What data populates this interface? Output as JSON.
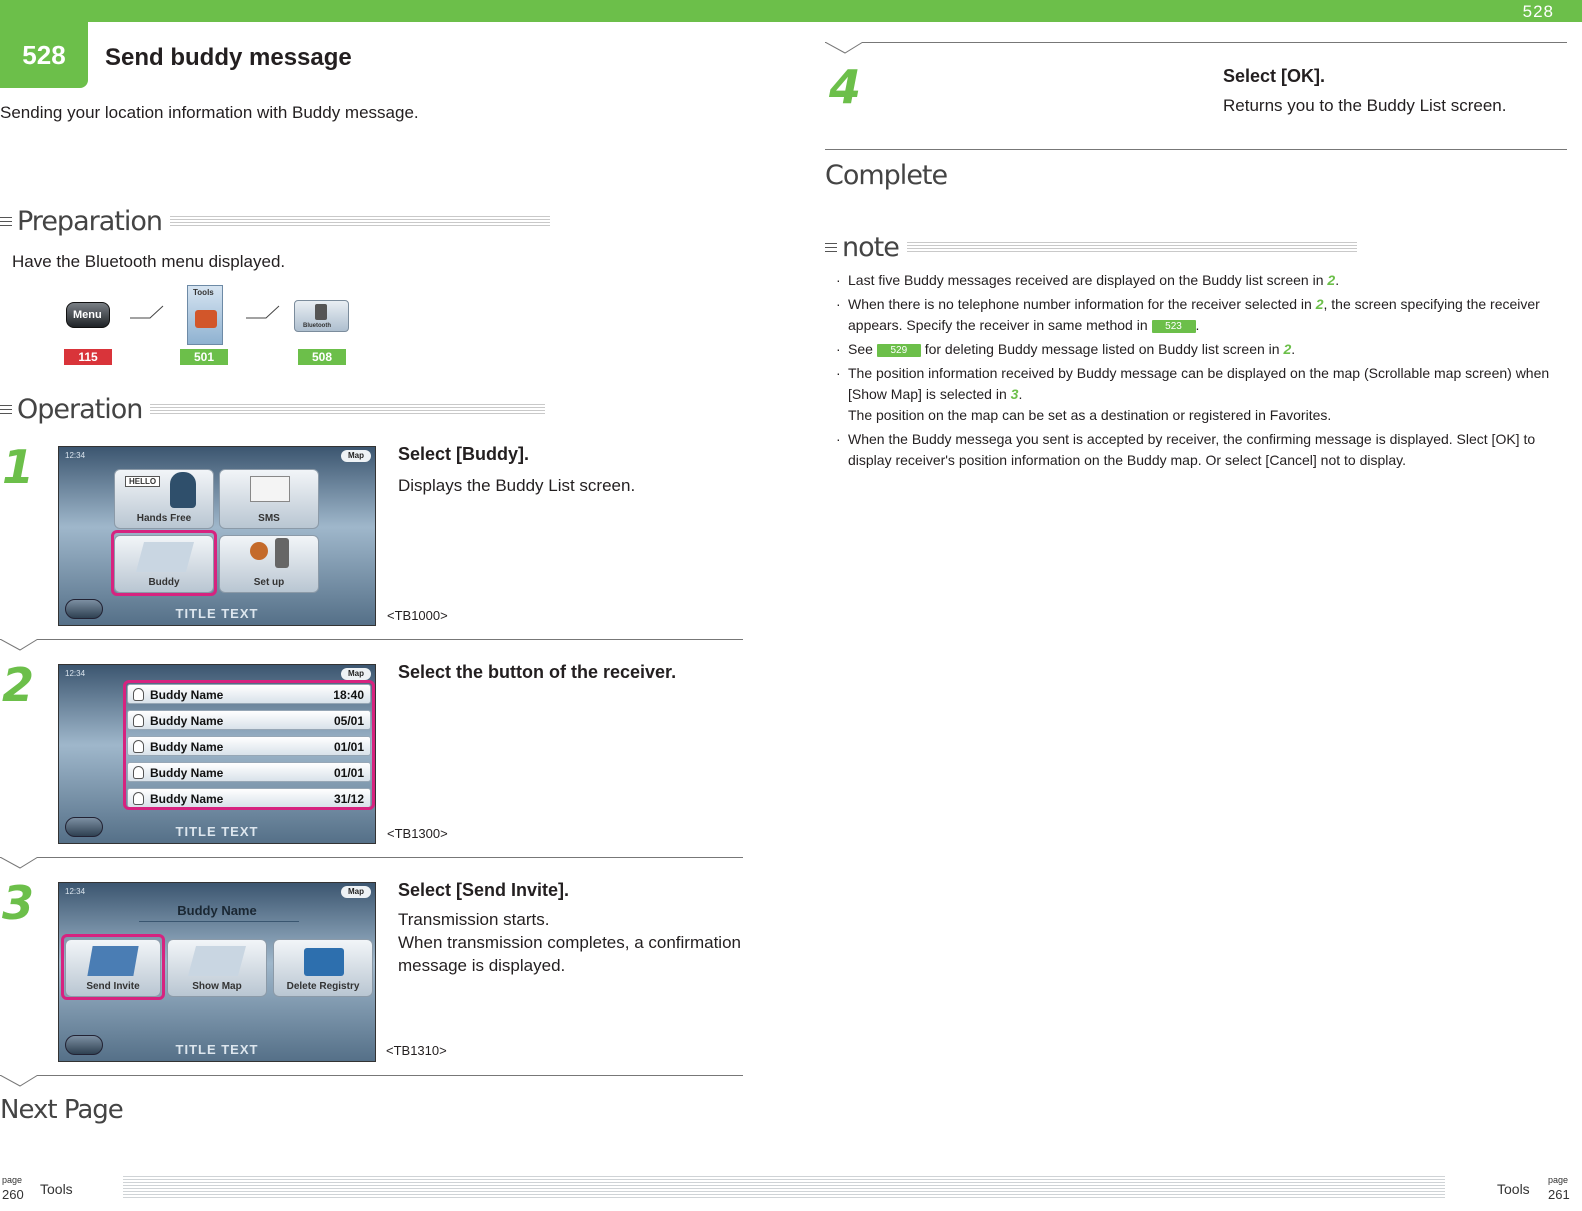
{
  "header": {
    "page_number": "528",
    "badge": "528",
    "title": "Send buddy message",
    "subtitle": "Sending your location information with Buddy message."
  },
  "preparation": {
    "heading": "Preparation",
    "text": "Have the Bluetooth menu displayed.",
    "icons": [
      {
        "label": "Menu",
        "tag": "115",
        "tag_color": "#d9343a"
      },
      {
        "label": "Tools",
        "tag": "501",
        "tag_color": "#6cbf4a"
      },
      {
        "label": "Bluetooth",
        "tag": "508",
        "tag_color": "#6cbf4a"
      }
    ]
  },
  "operation": {
    "heading": "Operation",
    "steps": [
      {
        "num": "1",
        "title": "Select [Buddy].",
        "desc": "Displays the Buddy List screen.",
        "code": "<TB1000>",
        "screen": {
          "clock": "12:34",
          "map": "Map",
          "title": "TITLE TEXT",
          "buttons": [
            "Hands Free",
            "SMS",
            "Buddy",
            "Set up"
          ],
          "hello": "HELLO"
        }
      },
      {
        "num": "2",
        "title": "Select the button of the receiver.",
        "desc": "",
        "code": "<TB1300>",
        "screen": {
          "clock": "12:34",
          "map": "Map",
          "title": "TITLE TEXT",
          "rows": [
            {
              "name": "Buddy Name",
              "time": "18:40"
            },
            {
              "name": "Buddy Name",
              "time": "05/01"
            },
            {
              "name": "Buddy Name",
              "time": "01/01"
            },
            {
              "name": "Buddy Name",
              "time": "01/01"
            },
            {
              "name": "Buddy Name",
              "time": "31/12"
            }
          ]
        }
      },
      {
        "num": "3",
        "title": "Select [Send Invite].",
        "desc_lines": [
          "Transmission starts.",
          "When transmission completes, a confirmation",
          "message is displayed."
        ],
        "code": "<TB1310>",
        "screen": {
          "clock": "12:34",
          "map": "Map",
          "title": "TITLE TEXT",
          "header": "Buddy Name",
          "buttons": [
            "Send Invite",
            "Show Map",
            "Delete Registry"
          ]
        }
      },
      {
        "num": "4",
        "title": "Select [OK].",
        "desc": "Returns you to the Buddy List screen."
      }
    ],
    "next_page": "Next Page",
    "complete": "Complete"
  },
  "note": {
    "heading": "note",
    "items": [
      {
        "parts": [
          "Last five Buddy messages received are displayed on the Buddy list screen in ",
          "2",
          "."
        ]
      },
      {
        "parts": [
          "When there is no telephone number information for the receiver selected in ",
          "2",
          ", the screen specifying the receiver appears. Specify the receiver in same method in ",
          "523",
          "."
        ]
      },
      {
        "parts": [
          "See ",
          "529",
          " for deleting Buddy message listed on Buddy list screen in ",
          "2",
          "."
        ]
      },
      {
        "parts": [
          "The position information received by Buddy message can be displayed on the map (Scrollable map screen) when [Show Map] is selected in ",
          "3",
          "."
        ],
        "line2": "The position on the map can be set as a destination or registered in Favorites."
      },
      {
        "parts": [
          "When the Buddy messega you sent is accepted by receiver, the confirming message is displayed. Slect [OK] to display receiver's position information on the Buddy map. Or select [Cancel] not to display."
        ]
      }
    ]
  },
  "footer": {
    "left_page_label": "page",
    "left_page": "260",
    "left_section": "Tools",
    "right_section": "Tools",
    "right_page_label": "page",
    "right_page": "261"
  },
  "colors": {
    "accent": "#6cbf4a",
    "highlight": "#d6237f",
    "red_tag": "#d9343a"
  }
}
